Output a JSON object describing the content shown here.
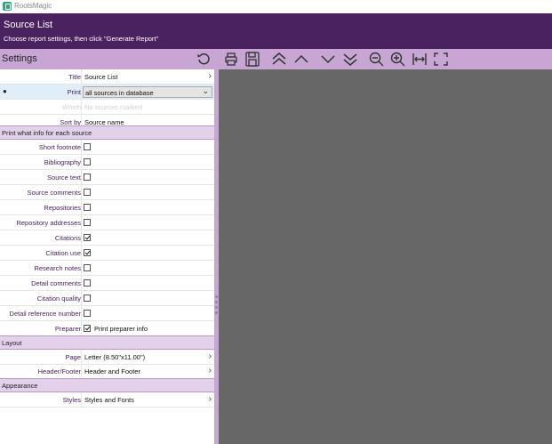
{
  "app": {
    "title": "RootsMagic"
  },
  "banner": {
    "title": "Source List",
    "subtitle": "Choose report settings, then click \"Generate Report\""
  },
  "settings": {
    "title": "Settings"
  },
  "rows": {
    "title": {
      "label": "Title",
      "value": "Source List"
    },
    "print": {
      "label": "Print",
      "value": "all sources in database"
    },
    "which": {
      "label": "Which",
      "value": "No sources marked"
    },
    "sort": {
      "label": "Sort by",
      "value": "Source name"
    }
  },
  "sections": {
    "info": "Print what info for each source",
    "layout": "Layout",
    "appearance": "Appearance"
  },
  "options": [
    {
      "label": "Short footnote",
      "checked": false
    },
    {
      "label": "Bibliography",
      "checked": false
    },
    {
      "label": "Source text",
      "checked": false
    },
    {
      "label": "Source comments",
      "checked": false
    },
    {
      "label": "Repositories",
      "checked": false
    },
    {
      "label": "Repository addresses",
      "checked": false
    },
    {
      "label": "Citations",
      "checked": true
    },
    {
      "label": "Citation use",
      "checked": true
    },
    {
      "label": "Research notes",
      "checked": false
    },
    {
      "label": "Detail comments",
      "checked": false
    },
    {
      "label": "Citation quality",
      "checked": false
    },
    {
      "label": "Detail reference number",
      "checked": false
    }
  ],
  "preparer": {
    "label": "Preparer",
    "checkbox_text": "Print preparer info",
    "checked": true
  },
  "layout": {
    "page": {
      "label": "Page",
      "value": "Letter (8.50\"x11.00\")"
    },
    "header": {
      "label": "Header/Footer",
      "value": "Header and Footer"
    }
  },
  "appearance": {
    "styles": {
      "label": "Styles",
      "value": "Styles and Fonts"
    }
  },
  "toolbar": {
    "icons": [
      "print-icon",
      "save-icon",
      "first-page-icon",
      "previous-page-icon",
      "next-page-icon",
      "last-page-icon",
      "zoom-out-icon",
      "zoom-in-icon",
      "fit-width-icon",
      "fit-page-icon"
    ]
  },
  "colors": {
    "banner": "#4a2260",
    "header": "#c7a6d3",
    "section": "#e3d0eb",
    "preview": "#676767",
    "label": "#4a2260"
  }
}
